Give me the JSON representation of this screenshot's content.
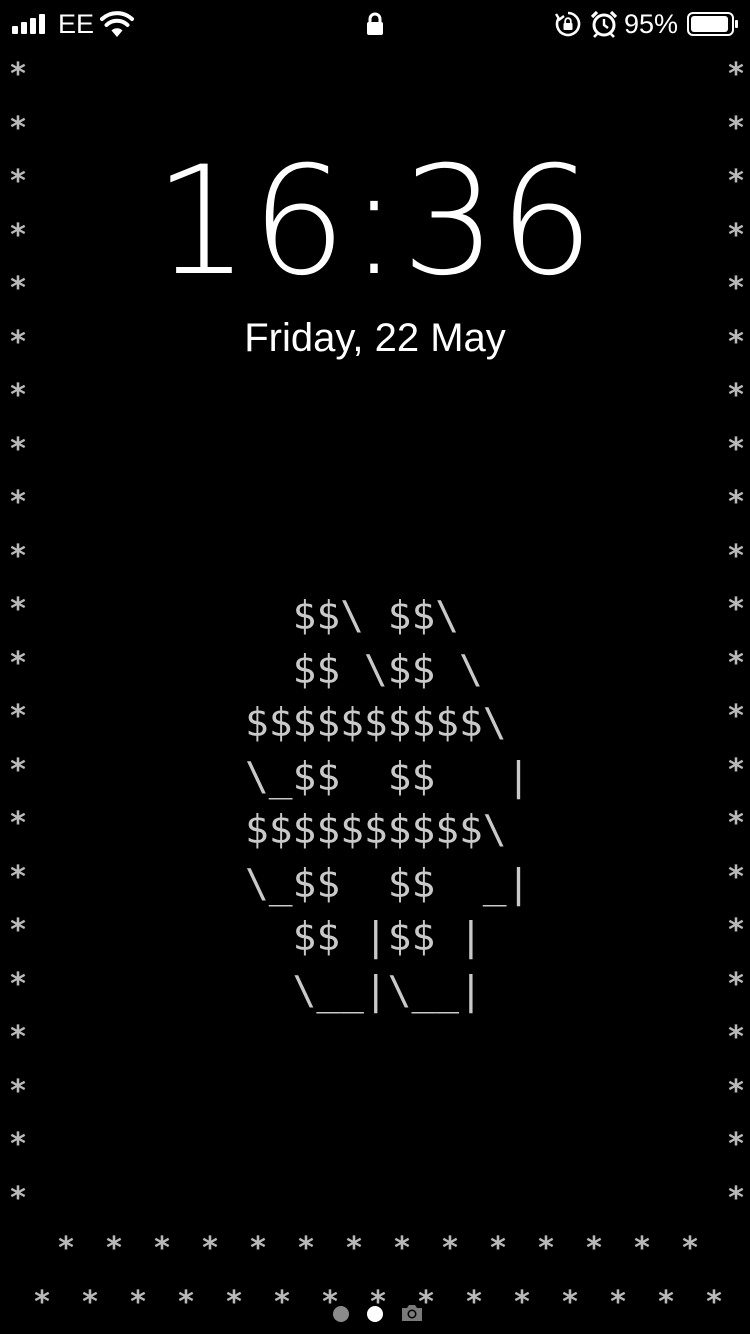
{
  "status_bar": {
    "carrier": "EE",
    "battery_percent_label": "95%",
    "battery_level": 0.95,
    "signal_bars": 4,
    "icons": [
      "signal-icon",
      "wifi-icon",
      "lock-icon",
      "rotation-lock-icon",
      "alarm-icon",
      "battery-icon"
    ]
  },
  "lock_screen": {
    "time": "16:36",
    "date": "Friday, 22 May"
  },
  "wallpaper": {
    "border_char": "*",
    "ascii_art": [
      "  $$\\ $$\\",
      "  $$ \\$$ \\",
      "$$$$$$$$$$\\",
      "\\_$$  $$   |",
      "$$$$$$$$$$\\",
      "\\_$$  $$  _|",
      "  $$ |$$ |",
      "  \\__|\\__|"
    ]
  },
  "page_indicator": {
    "pages": 2,
    "current": 2,
    "camera_icon": "camera-icon"
  },
  "colors": {
    "background": "#000000",
    "text": "#ffffff",
    "ascii": "#c9c9c9",
    "border_star": "#b9b9b9",
    "dot_inactive": "#8a8a8a",
    "dot_active": "#ffffff"
  }
}
